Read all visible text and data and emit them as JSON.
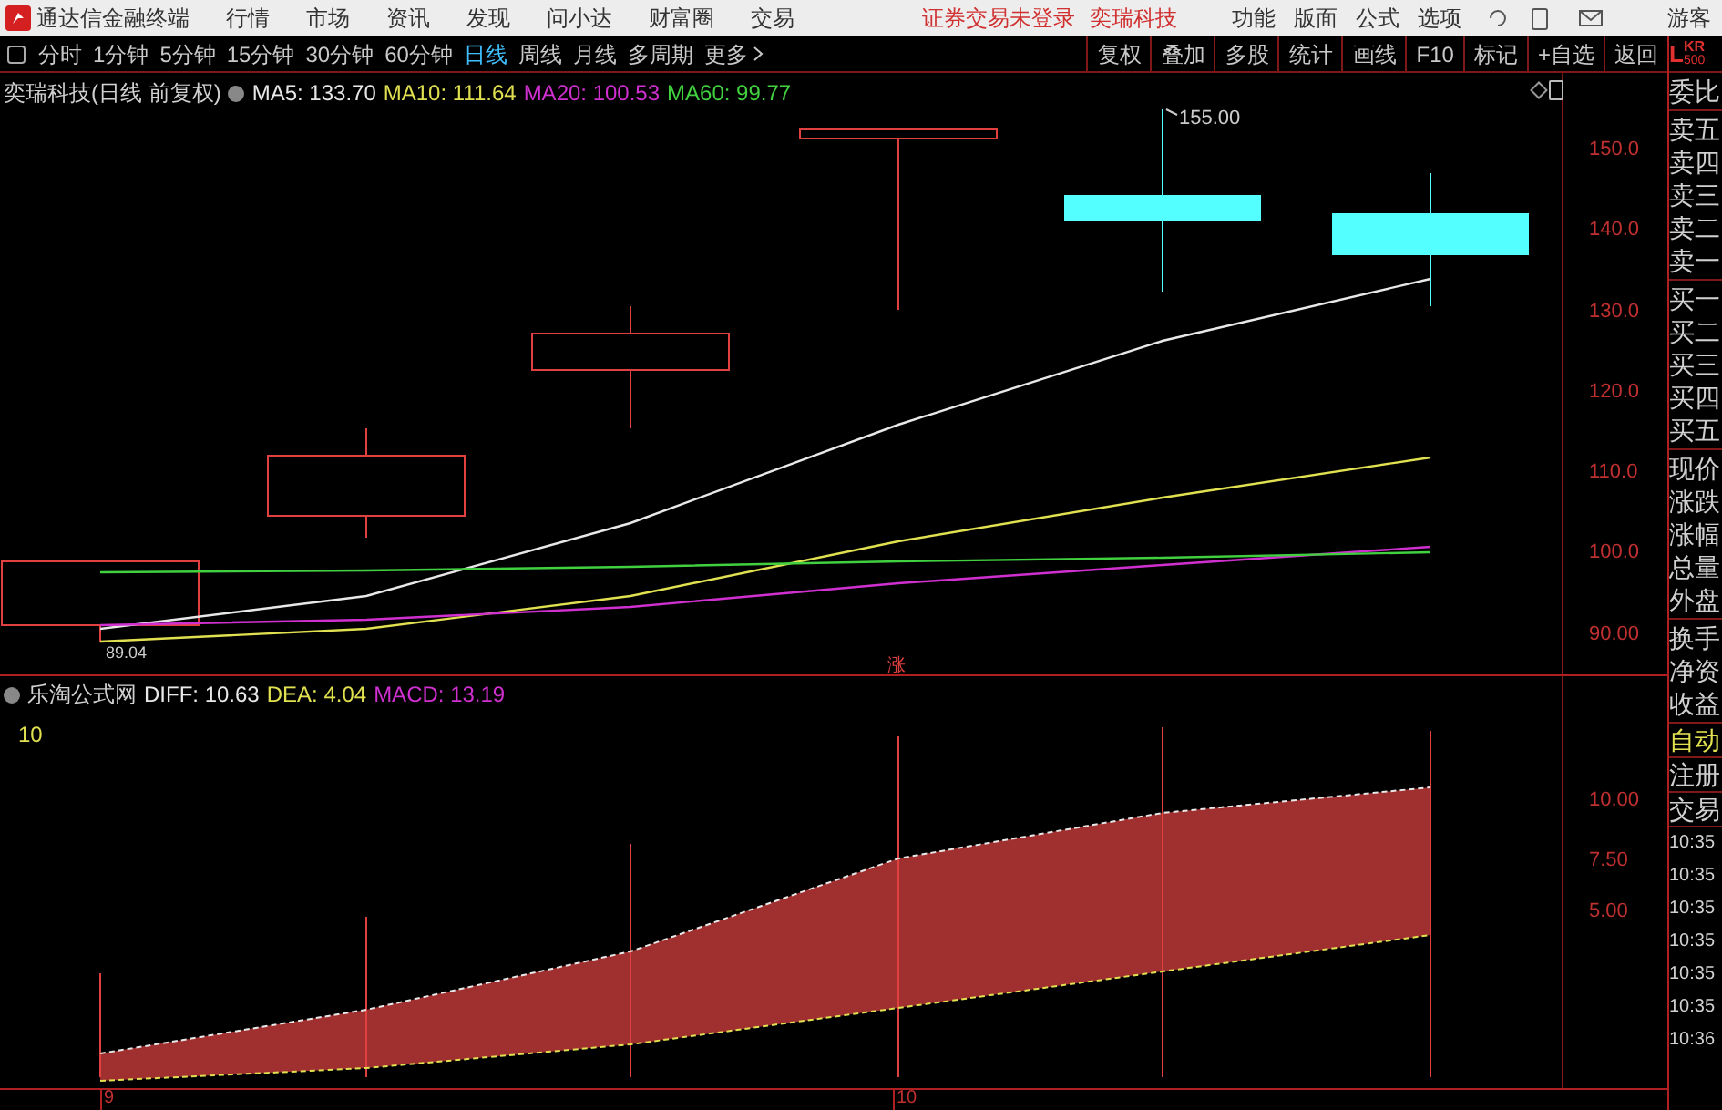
{
  "app": {
    "title": "通达信金融终端"
  },
  "menu": [
    "行情",
    "市场",
    "资讯",
    "发现",
    "问小达",
    "财富圈",
    "交易"
  ],
  "login_notice": {
    "status": "证券交易未登录",
    "stock": "奕瑞科技"
  },
  "right_menu": [
    "功能",
    "版面",
    "公式",
    "选项"
  ],
  "user": "游客",
  "periods": [
    {
      "label": "分时",
      "selected": false
    },
    {
      "label": "1分钟",
      "selected": false
    },
    {
      "label": "5分钟",
      "selected": false
    },
    {
      "label": "15分钟",
      "selected": false
    },
    {
      "label": "30分钟",
      "selected": false
    },
    {
      "label": "60分钟",
      "selected": false
    },
    {
      "label": "日线",
      "selected": true
    },
    {
      "label": "周线",
      "selected": false
    },
    {
      "label": "月线",
      "selected": false
    },
    {
      "label": "多周期",
      "selected": false
    },
    {
      "label": "更多",
      "selected": false
    }
  ],
  "tools": [
    "复权",
    "叠加",
    "多股",
    "统计",
    "画线",
    "F10",
    "标记",
    "+自选",
    "返回"
  ],
  "price_chart": {
    "title": "奕瑞科技(日线 前复权)",
    "indicators": [
      {
        "label": "MA5: 133.70",
        "color": "#e8e8e8"
      },
      {
        "label": "MA10: 111.64",
        "color": "#e0e050"
      },
      {
        "label": "MA20: 100.53",
        "color": "#d030d0"
      },
      {
        "label": "MA60: 99.77",
        "color": "#40d040"
      }
    ],
    "yticks": [
      "150.0",
      "140.0",
      "130.0",
      "120.0",
      "110.0",
      "100.0",
      "90.00"
    ],
    "high_label": "155.00",
    "low_label": "89.04",
    "marker": "涨"
  },
  "macd_chart": {
    "title": "乐淘公式网",
    "indicators": [
      {
        "label": "DIFF: 10.63",
        "color": "#e8e8e8"
      },
      {
        "label": "DEA: 4.04",
        "color": "#e0e050"
      },
      {
        "label": "MACD: 13.19",
        "color": "#d030d0"
      }
    ],
    "value": "10",
    "yticks": [
      "10.00",
      "7.50",
      "5.00"
    ]
  },
  "x_axis": [
    "9",
    "10"
  ],
  "side_panel": {
    "badge": "L",
    "code": "KR",
    "sub": "500",
    "groups": [
      [
        "委比"
      ],
      [
        "卖五",
        "卖四",
        "卖三",
        "卖二",
        "卖一"
      ],
      [
        "买一",
        "买二",
        "买三",
        "买四",
        "买五"
      ],
      [
        "现价",
        "涨跌",
        "涨幅",
        "总量",
        "外盘"
      ],
      [
        "换手",
        "净资",
        "收益"
      ]
    ],
    "buttons": [
      {
        "label": "自动",
        "selected": true
      },
      {
        "label": "注册",
        "selected": false
      },
      {
        "label": "交易",
        "selected": false
      }
    ],
    "times": [
      "10:35",
      "10:35",
      "10:35",
      "10:35",
      "10:35",
      "10:35",
      "10:36"
    ]
  }
}
